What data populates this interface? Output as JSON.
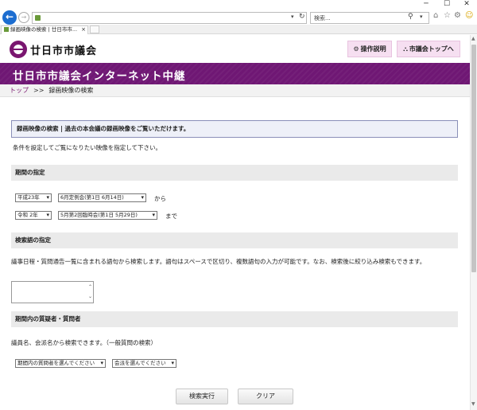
{
  "window": {
    "minimize": "─",
    "maximize": "☐",
    "close": "✕"
  },
  "nav": {
    "back": "←",
    "forward": "→",
    "address_drop": "▾",
    "refresh": "↻",
    "search_placeholder": "検索...",
    "search_icon": "⚲",
    "search_drop": "▾"
  },
  "toolbar": {
    "home": "⌂",
    "favorites": "☆",
    "settings": "⚙",
    "feedback": "☺"
  },
  "tab": {
    "label": "録画映像の検索 | 廿日市市...",
    "close": "×"
  },
  "header": {
    "logo_text": "廿日市市議会",
    "help_icon": "⚙",
    "help_label": "操作説明",
    "top_icon": "⛬",
    "top_label": "市議会トップへ"
  },
  "banner": {
    "title": "廿日市市議会インターネット中継"
  },
  "breadcrumb": {
    "home": "トップ",
    "separator": ">>",
    "current": "録画映像の検索"
  },
  "info": {
    "text": "録画映像の検索 | 過去の本会議の録画映像をご覧いただけます。"
  },
  "intro": "条件を設定してご覧になりたい映像を指定して下さい。",
  "period": {
    "heading": "期間の指定",
    "from_year": "平成23年",
    "from_session": "6月定例会(第1日 6月14日)",
    "from_label": "から",
    "to_year": "令和 2年",
    "to_session": "5月第2回臨時会(第1日 5月29日)",
    "to_label": "まで",
    "arrow": "▾"
  },
  "keyword": {
    "heading": "検索語の指定",
    "description": "議事日程・質問通告一覧に含まれる語句から検索します。語句はスペースで区切り、複数語句の入力が可能です。なお、検索後に絞り込み検索もできます。",
    "value": ""
  },
  "member": {
    "heading": "期間内の質疑者・質問者",
    "description": "議員名、会派名から検索できます。（一般質問の検索）",
    "member_select": "期間内の質問者を選んでください",
    "faction_select": "会派を選んでください"
  },
  "actions": {
    "search": "検索実行",
    "clear": "クリア"
  },
  "colors": {
    "brand": "#6f1774",
    "header_button": "#f6dff1",
    "info_box": "#eef0f8"
  }
}
